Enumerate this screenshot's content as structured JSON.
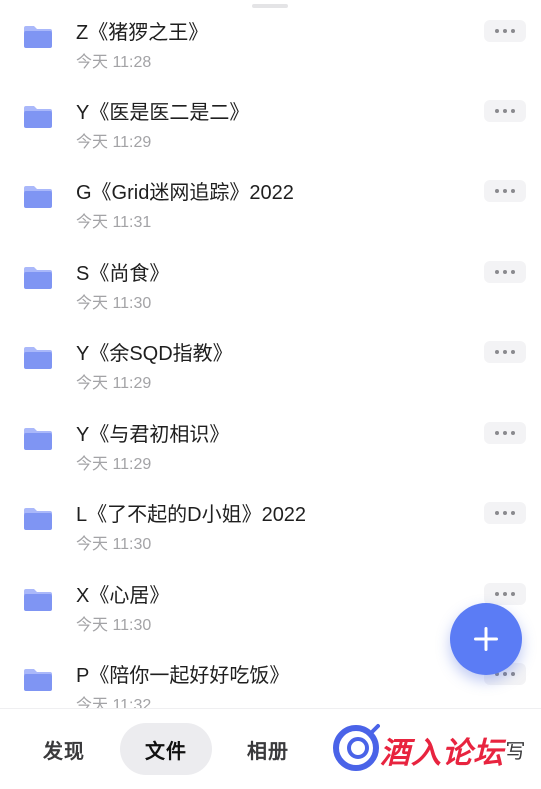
{
  "files": [
    {
      "name": "Z《猪猡之王》",
      "time": "今天 11:28"
    },
    {
      "name": "Y《医是医二是二》",
      "time": "今天 11:29"
    },
    {
      "name": "G《Grid迷网追踪》2022",
      "time": "今天 11:31"
    },
    {
      "name": "S《尚食》",
      "time": "今天 11:30"
    },
    {
      "name": "Y《余SQD指教》",
      "time": "今天 11:29"
    },
    {
      "name": "Y《与君初相识》",
      "time": "今天 11:29"
    },
    {
      "name": "L《了不起的D小姐》2022",
      "time": "今天 11:30"
    },
    {
      "name": "X《心居》",
      "time": "今天 11:30"
    },
    {
      "name": "P《陪你一起好好吃饭》",
      "time": "今天 11:32"
    }
  ],
  "nav": {
    "discover": "发现",
    "files": "文件",
    "album": "相册",
    "partial_label": "写"
  },
  "watermark": {
    "text": "酒入论坛"
  },
  "icons": {
    "folder": "folder-icon",
    "more": "more-icon",
    "fab": "plus-icon"
  },
  "colors": {
    "accent": "#5b7cf5",
    "folder_light": "#c3cdfb",
    "folder_dark": "#7f95f3",
    "watermark": "#e8243f"
  },
  "active_tab": "files"
}
